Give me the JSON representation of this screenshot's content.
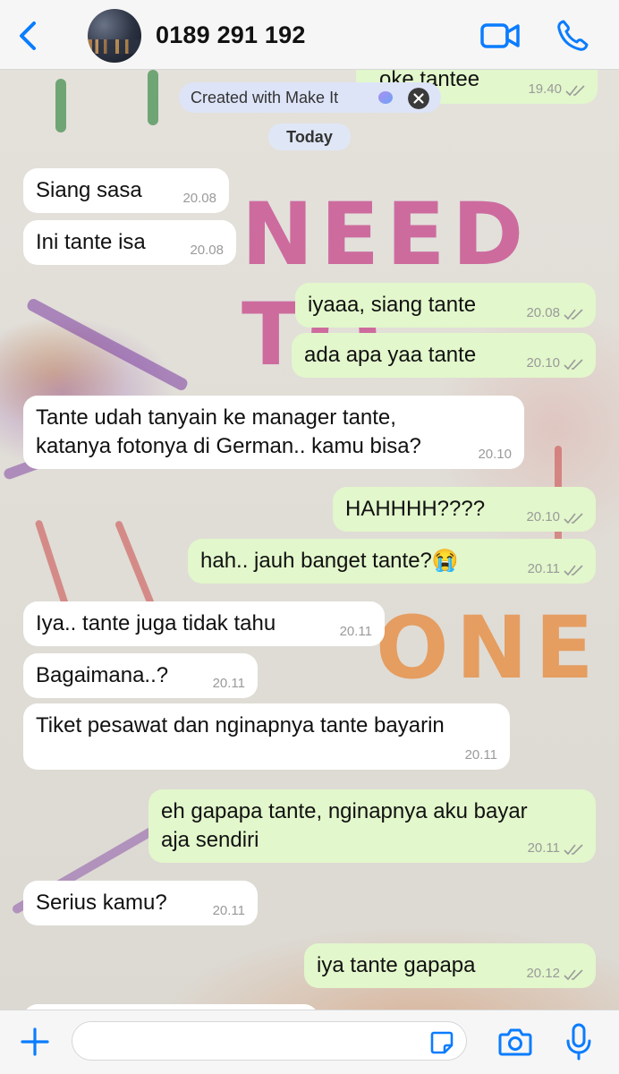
{
  "header": {
    "back_icon": "chevron-left-icon",
    "avatar_icon": "city-night-avatar",
    "contact_name": "0189 291 192",
    "video_icon": "video-camera-icon",
    "call_icon": "phone-icon"
  },
  "accent_color": "#0a7cff",
  "bubble_colors": {
    "incoming": "#ffffff",
    "outgoing": "#e2f7cb"
  },
  "watermark": {
    "label": "Created with Make It",
    "close_icon": "close-circle-icon"
  },
  "date_label": "Today",
  "messages": [
    {
      "dir": "out",
      "text": "oke tantee",
      "time": "19.40",
      "ticks": "read"
    },
    {
      "dir": "in",
      "text": "Siang sasa",
      "time": "20.08"
    },
    {
      "dir": "in",
      "text": "Ini tante isa",
      "time": "20.08"
    },
    {
      "dir": "out",
      "text": "iyaaa, siang tante",
      "time": "20.08",
      "ticks": "read"
    },
    {
      "dir": "out",
      "text": "ada apa yaa tante",
      "time": "20.10",
      "ticks": "read"
    },
    {
      "dir": "in",
      "text": "Tante udah tanyain ke manager tante,\nkatanya fotonya di German.. kamu bisa?",
      "time": "20.10"
    },
    {
      "dir": "out",
      "text": "HAHHHH????",
      "time": "20.10",
      "ticks": "read"
    },
    {
      "dir": "out",
      "text": "hah.. jauh banget tante?😭",
      "time": "20.11",
      "ticks": "read"
    },
    {
      "dir": "in",
      "text": "Iya.. tante juga tidak tahu",
      "time": "20.11"
    },
    {
      "dir": "in",
      "text": "Bagaimana..?",
      "time": "20.11"
    },
    {
      "dir": "in",
      "text": "Tiket pesawat dan nginapnya tante bayarin",
      "time": "20.11"
    },
    {
      "dir": "out",
      "text": "eh gapapa tante, nginapnya aku bayar\naja sendiri",
      "time": "20.11",
      "ticks": "read"
    },
    {
      "dir": "in",
      "text": "Serius kamu?",
      "time": "20.11"
    },
    {
      "dir": "out",
      "text": "iya tante gapapa",
      "time": "20.12",
      "ticks": "read"
    }
  ],
  "background_doodle": {
    "texts": [
      "NEED TO",
      "ONE"
    ]
  },
  "composer": {
    "plus_icon": "plus-icon",
    "placeholder": "",
    "sticker_icon": "sticker-icon",
    "camera_icon": "camera-icon",
    "mic_icon": "microphone-icon"
  }
}
